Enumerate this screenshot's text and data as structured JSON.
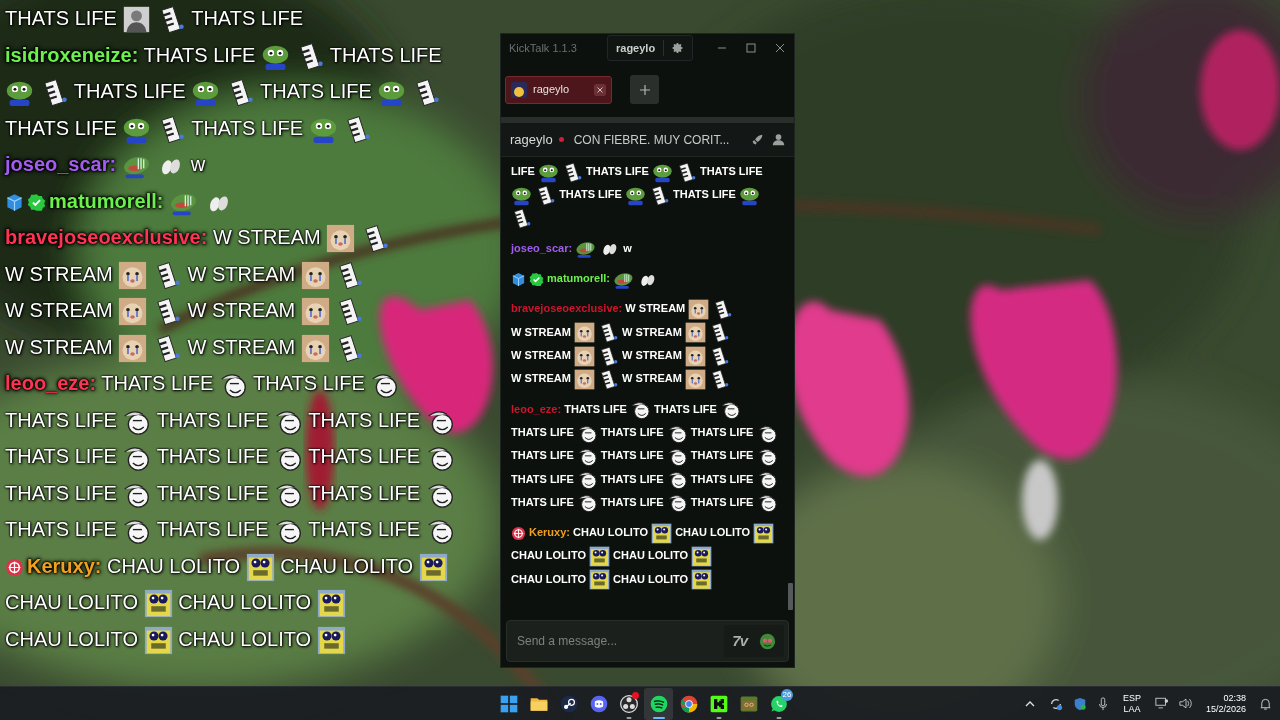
{
  "overlay": {
    "messages": [
      {
        "parts": [
          {
            "kind": "text",
            "text": "THATS LIFE"
          },
          {
            "kind": "person"
          },
          {
            "kind": "piano"
          },
          {
            "kind": "text",
            "text": "THATS LIFE"
          }
        ]
      },
      {
        "username": "isidroxeneize:",
        "color": "#6cf04c",
        "parts": [
          {
            "kind": "text",
            "text": "THATS LIFE"
          },
          {
            "kind": "frog"
          },
          {
            "kind": "piano"
          },
          {
            "kind": "text",
            "text": "THATS LIFE"
          },
          {
            "kind": "frog"
          },
          {
            "kind": "piano"
          },
          {
            "kind": "text",
            "text": "THATS LIFE"
          },
          {
            "kind": "frog"
          },
          {
            "kind": "piano"
          },
          {
            "kind": "text",
            "text": "THATS LIFE"
          },
          {
            "kind": "frog"
          },
          {
            "kind": "piano"
          },
          {
            "kind": "text",
            "text": "THATS LIFE"
          },
          {
            "kind": "frog"
          },
          {
            "kind": "piano"
          },
          {
            "kind": "text",
            "text": "THATS LIFE"
          },
          {
            "kind": "frog"
          },
          {
            "kind": "piano"
          }
        ]
      },
      {
        "username": "joseo_scar:",
        "color": "#a35cf0",
        "parts": [
          {
            "kind": "cryfrog"
          },
          {
            "kind": "hand"
          },
          {
            "kind": "text",
            "text": "w"
          }
        ]
      },
      {
        "badges": [
          {
            "kind": "cube"
          },
          {
            "kind": "verified"
          }
        ],
        "username": "matumorell:",
        "color": "#6cf04c",
        "parts": [
          {
            "kind": "cryfrog"
          },
          {
            "kind": "hand"
          }
        ]
      },
      {
        "username": "bravejoseoexclusive:",
        "color": "#ff3352",
        "parts": [
          {
            "kind": "text",
            "text": "W STREAM"
          },
          {
            "kind": "cat"
          },
          {
            "kind": "piano"
          },
          {
            "kind": "text",
            "text": "W STREAM"
          },
          {
            "kind": "cat"
          },
          {
            "kind": "piano"
          },
          {
            "kind": "text",
            "text": "W STREAM"
          },
          {
            "kind": "cat"
          },
          {
            "kind": "piano"
          },
          {
            "kind": "text",
            "text": "W STREAM"
          },
          {
            "kind": "cat"
          },
          {
            "kind": "piano"
          },
          {
            "kind": "text",
            "text": "W STREAM"
          },
          {
            "kind": "cat"
          },
          {
            "kind": "piano"
          },
          {
            "kind": "text",
            "text": "W STREAM"
          },
          {
            "kind": "cat"
          },
          {
            "kind": "piano"
          },
          {
            "kind": "text",
            "text": "W STREAM"
          },
          {
            "kind": "cat"
          },
          {
            "kind": "piano"
          }
        ]
      },
      {
        "username": "leoo_eze:",
        "color": "#ff3352",
        "parts": [
          {
            "kind": "text",
            "text": "THATS LIFE"
          },
          {
            "kind": "troll"
          },
          {
            "kind": "text",
            "text": "THATS LIFE"
          },
          {
            "kind": "troll"
          },
          {
            "kind": "text",
            "text": "THATS LIFE"
          },
          {
            "kind": "troll"
          },
          {
            "kind": "text",
            "text": "THATS LIFE"
          },
          {
            "kind": "troll"
          },
          {
            "kind": "text",
            "text": "THATS LIFE"
          },
          {
            "kind": "troll"
          },
          {
            "kind": "text",
            "text": "THATS LIFE"
          },
          {
            "kind": "troll"
          },
          {
            "kind": "text",
            "text": "THATS LIFE"
          },
          {
            "kind": "troll"
          },
          {
            "kind": "text",
            "text": "THATS LIFE"
          },
          {
            "kind": "troll"
          },
          {
            "kind": "text",
            "text": "THATS LIFE"
          },
          {
            "kind": "troll"
          },
          {
            "kind": "text",
            "text": "THATS LIFE"
          },
          {
            "kind": "troll"
          },
          {
            "kind": "text",
            "text": "THATS LIFE"
          },
          {
            "kind": "troll"
          },
          {
            "kind": "text",
            "text": "THATS LIFE"
          },
          {
            "kind": "troll"
          },
          {
            "kind": "text",
            "text": "THATS LIFE"
          },
          {
            "kind": "troll"
          },
          {
            "kind": "text",
            "text": "THATS LIFE"
          },
          {
            "kind": "troll"
          }
        ]
      },
      {
        "badges": [
          {
            "kind": "target"
          }
        ],
        "username": "Keruxy:",
        "color": "#f0a020",
        "parts": [
          {
            "kind": "text",
            "text": "CHAU LOLITO"
          },
          {
            "kind": "sponge"
          },
          {
            "kind": "text",
            "text": "CHAU LOLITO"
          },
          {
            "kind": "sponge"
          },
          {
            "kind": "text",
            "text": "CHAU LOLITO"
          },
          {
            "kind": "sponge"
          },
          {
            "kind": "text",
            "text": "CHAU LOLITO"
          },
          {
            "kind": "sponge"
          },
          {
            "kind": "text",
            "text": "CHAU LOLITO"
          },
          {
            "kind": "sponge"
          },
          {
            "kind": "text",
            "text": "CHAU LOLITO"
          },
          {
            "kind": "sponge"
          }
        ]
      }
    ]
  },
  "window": {
    "title": "KickTalk 1.1.3",
    "account": "rageylo"
  },
  "tabs": [
    {
      "label": "rageylo",
      "selected": true
    }
  ],
  "channel_header": {
    "name": "rageylo",
    "live": true,
    "stream_title": "CON FIEBRE. MUY CORIT..."
  },
  "chat": {
    "messages": [
      {
        "parts": [
          {
            "kind": "text",
            "text": "LIFE"
          },
          {
            "kind": "frog"
          },
          {
            "kind": "piano"
          },
          {
            "kind": "text",
            "text": "THATS LIFE"
          },
          {
            "kind": "frog"
          },
          {
            "kind": "piano"
          },
          {
            "kind": "text",
            "text": "THATS LIFE"
          },
          {
            "kind": "frog"
          },
          {
            "kind": "piano"
          },
          {
            "kind": "text",
            "text": "THATS LIFE"
          },
          {
            "kind": "frog"
          },
          {
            "kind": "piano"
          },
          {
            "kind": "text",
            "text": "THATS LIFE"
          },
          {
            "kind": "frog"
          },
          {
            "kind": "piano"
          }
        ]
      },
      {
        "username": "joseo_scar:",
        "color": "#a35cf0",
        "parts": [
          {
            "kind": "cryfrog"
          },
          {
            "kind": "hand"
          },
          {
            "kind": "text",
            "text": "w"
          }
        ]
      },
      {
        "badges": [
          {
            "kind": "cube"
          },
          {
            "kind": "verified"
          }
        ],
        "username": "matumorell:",
        "color": "#6cf04c",
        "parts": [
          {
            "kind": "cryfrog"
          },
          {
            "kind": "hand"
          }
        ]
      },
      {
        "username": "bravejoseoexclusive:",
        "color": "#d0142c",
        "parts": [
          {
            "kind": "text",
            "text": "W STREAM"
          },
          {
            "kind": "cat"
          },
          {
            "kind": "piano"
          },
          {
            "kind": "text",
            "text": "W STREAM"
          },
          {
            "kind": "cat"
          },
          {
            "kind": "piano"
          },
          {
            "kind": "text",
            "text": "W STREAM"
          },
          {
            "kind": "cat"
          },
          {
            "kind": "piano"
          },
          {
            "kind": "text",
            "text": "W STREAM"
          },
          {
            "kind": "cat"
          },
          {
            "kind": "piano"
          },
          {
            "kind": "text",
            "text": "W STREAM"
          },
          {
            "kind": "cat"
          },
          {
            "kind": "piano"
          },
          {
            "kind": "text",
            "text": "W STREAM"
          },
          {
            "kind": "cat"
          },
          {
            "kind": "piano"
          },
          {
            "kind": "text",
            "text": "W STREAM"
          },
          {
            "kind": "cat"
          },
          {
            "kind": "piano"
          }
        ]
      },
      {
        "username": "leoo_eze:",
        "color": "#d0142c",
        "parts": [
          {
            "kind": "text",
            "text": "THATS LIFE"
          },
          {
            "kind": "troll"
          },
          {
            "kind": "text",
            "text": "THATS LIFE"
          },
          {
            "kind": "troll"
          },
          {
            "kind": "text",
            "text": "THATS LIFE"
          },
          {
            "kind": "troll"
          },
          {
            "kind": "text",
            "text": "THATS LIFE"
          },
          {
            "kind": "troll"
          },
          {
            "kind": "text",
            "text": "THATS LIFE"
          },
          {
            "kind": "troll"
          },
          {
            "kind": "text",
            "text": "THATS LIFE"
          },
          {
            "kind": "troll"
          },
          {
            "kind": "text",
            "text": "THATS LIFE"
          },
          {
            "kind": "troll"
          },
          {
            "kind": "text",
            "text": "THATS LIFE"
          },
          {
            "kind": "troll"
          },
          {
            "kind": "text",
            "text": "THATS LIFE"
          },
          {
            "kind": "troll"
          },
          {
            "kind": "text",
            "text": "THATS LIFE"
          },
          {
            "kind": "troll"
          },
          {
            "kind": "text",
            "text": "THATS LIFE"
          },
          {
            "kind": "troll"
          },
          {
            "kind": "text",
            "text": "THATS LIFE"
          },
          {
            "kind": "troll"
          },
          {
            "kind": "text",
            "text": "THATS LIFE"
          },
          {
            "kind": "troll"
          },
          {
            "kind": "text",
            "text": "THATS LIFE"
          },
          {
            "kind": "troll"
          }
        ]
      },
      {
        "badges": [
          {
            "kind": "target"
          }
        ],
        "username": "Keruxy:",
        "color": "#f0a020",
        "parts": [
          {
            "kind": "text",
            "text": "CHAU LOLITO"
          },
          {
            "kind": "sponge"
          },
          {
            "kind": "text",
            "text": "CHAU LOLITO"
          },
          {
            "kind": "sponge"
          },
          {
            "kind": "text",
            "text": "CHAU LOLITO"
          },
          {
            "kind": "sponge"
          },
          {
            "kind": "text",
            "text": "CHAU LOLITO"
          },
          {
            "kind": "sponge"
          },
          {
            "kind": "text",
            "text": "CHAU LOLITO"
          },
          {
            "kind": "sponge"
          },
          {
            "kind": "text",
            "text": "CHAU LOLITO"
          },
          {
            "kind": "sponge"
          }
        ]
      }
    ]
  },
  "composer": {
    "placeholder": "Send a message...",
    "emote_menu_label": "7v"
  },
  "taskbar": {
    "apps": [
      {
        "kind": "start",
        "running": false,
        "selected": false
      },
      {
        "kind": "folder",
        "running": false,
        "selected": false
      },
      {
        "kind": "steam",
        "running": false,
        "selected": false
      },
      {
        "kind": "discord",
        "running": false,
        "selected": false
      },
      {
        "kind": "obs",
        "running": true,
        "selected": false,
        "alert": true
      },
      {
        "kind": "spotify",
        "running": true,
        "selected": true
      },
      {
        "kind": "chrome",
        "running": false,
        "selected": false
      },
      {
        "kind": "kick",
        "running": true,
        "selected": false
      },
      {
        "kind": "game",
        "running": false,
        "selected": false
      },
      {
        "kind": "whatsapp",
        "running": true,
        "selected": false,
        "badge": "26"
      }
    ],
    "tray": {
      "language": "ESP",
      "layout": "LAA",
      "time": "02:38",
      "date": "15/2/2026"
    }
  }
}
